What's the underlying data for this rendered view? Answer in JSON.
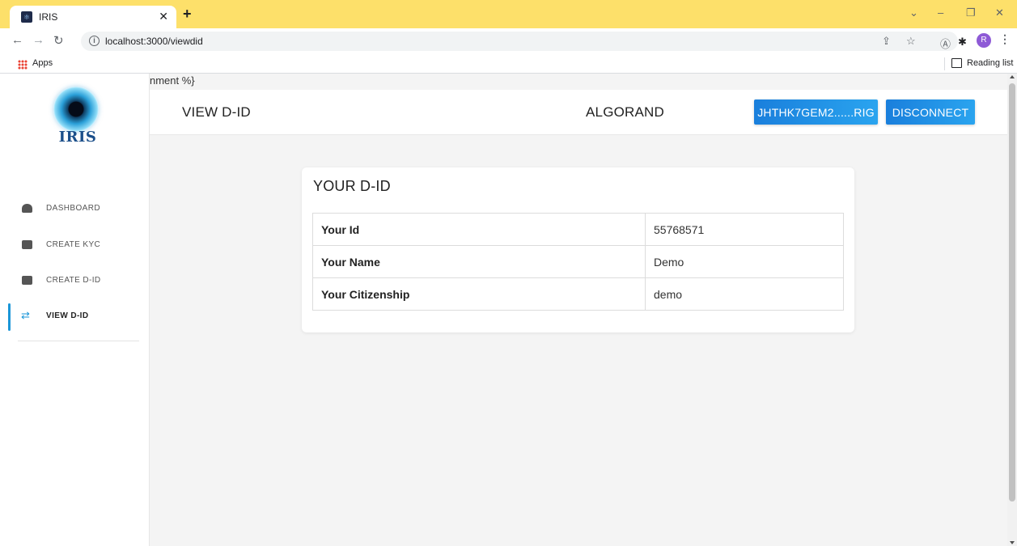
{
  "browser": {
    "tab_title": "IRIS",
    "url": "localhost:3000/viewdid",
    "bookmarks_apps": "Apps",
    "reading_list": "Reading list",
    "profile_initial": "R"
  },
  "sidebar": {
    "logo_text": "IRIS",
    "items": [
      {
        "label": "DASHBOARD",
        "icon": "dashboard-icon"
      },
      {
        "label": "CREATE KYC",
        "icon": "wallet-icon"
      },
      {
        "label": "CREATE D-ID",
        "icon": "wallet-icon"
      },
      {
        "label": "VIEW D-ID",
        "icon": "swap-icon",
        "active": true
      }
    ],
    "accent_color": "#1a96d8"
  },
  "template_leak": "nment %}",
  "header": {
    "title": "VIEW D-ID",
    "network": "ALGORAND",
    "address_button": "JHTHK7GEM2......RIG",
    "disconnect_button": "DISCONNECT"
  },
  "card": {
    "title": "YOUR D-ID",
    "rows": [
      {
        "label": "Your Id",
        "value": "55768571"
      },
      {
        "label": "Your Name",
        "value": "Demo"
      },
      {
        "label": "Your Citizenship",
        "value": "demo"
      }
    ]
  }
}
